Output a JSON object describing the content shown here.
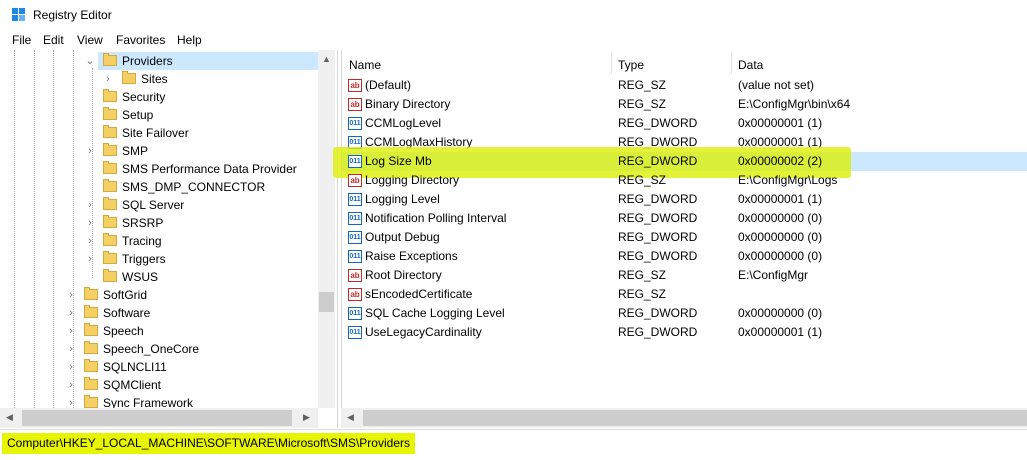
{
  "window": {
    "title": "Registry Editor"
  },
  "menu": [
    "File",
    "Edit",
    "View",
    "Favorites",
    "Help"
  ],
  "tree": {
    "nodes": [
      {
        "label": "Providers",
        "expanded": true
      },
      {
        "label": "Sites"
      },
      {
        "label": "Security"
      },
      {
        "label": "Setup"
      },
      {
        "label": "Site Failover"
      },
      {
        "label": "SMP"
      },
      {
        "label": "SMS Performance Data Provider"
      },
      {
        "label": "SMS_DMP_CONNECTOR"
      },
      {
        "label": "SQL Server"
      },
      {
        "label": "SRSRP"
      },
      {
        "label": "Tracing"
      },
      {
        "label": "Triggers"
      },
      {
        "label": "WSUS"
      },
      {
        "label": "SoftGrid"
      },
      {
        "label": "Software"
      },
      {
        "label": "Speech"
      },
      {
        "label": "Speech_OneCore"
      },
      {
        "label": "SQLNCLI11"
      },
      {
        "label": "SQMClient"
      },
      {
        "label": "Sync Framework"
      }
    ]
  },
  "list": {
    "columns": [
      "Name",
      "Type",
      "Data"
    ],
    "rows": [
      {
        "name": "(Default)",
        "type": "REG_SZ",
        "data": "(value not set)",
        "icon": "string-value-icon"
      },
      {
        "name": "Binary Directory",
        "type": "REG_SZ",
        "data": "E:\\ConfigMgr\\bin\\x64",
        "icon": "string-value-icon"
      },
      {
        "name": "CCMLogLevel",
        "type": "REG_DWORD",
        "data": "0x00000001 (1)",
        "icon": "dword-value-icon"
      },
      {
        "name": "CCMLogMaxHistory",
        "type": "REG_DWORD",
        "data": "0x00000001 (1)",
        "icon": "dword-value-icon"
      },
      {
        "name": "Log Size Mb",
        "type": "REG_DWORD",
        "data": "0x00000002 (2)",
        "icon": "dword-value-icon"
      },
      {
        "name": "Logging Directory",
        "type": "REG_SZ",
        "data": "E:\\ConfigMgr\\Logs",
        "icon": "string-value-icon"
      },
      {
        "name": "Logging Level",
        "type": "REG_DWORD",
        "data": "0x00000001 (1)",
        "icon": "dword-value-icon"
      },
      {
        "name": "Notification Polling Interval",
        "type": "REG_DWORD",
        "data": "0x00000000 (0)",
        "icon": "dword-value-icon"
      },
      {
        "name": "Output Debug",
        "type": "REG_DWORD",
        "data": "0x00000000 (0)",
        "icon": "dword-value-icon"
      },
      {
        "name": "Raise Exceptions",
        "type": "REG_DWORD",
        "data": "0x00000000 (0)",
        "icon": "dword-value-icon"
      },
      {
        "name": "Root Directory",
        "type": "REG_SZ",
        "data": "E:\\ConfigMgr",
        "icon": "string-value-icon"
      },
      {
        "name": "sEncodedCertificate",
        "type": "REG_SZ",
        "data": "",
        "icon": "string-value-icon"
      },
      {
        "name": "SQL Cache Logging Level",
        "type": "REG_DWORD",
        "data": "0x00000000 (0)",
        "icon": "dword-value-icon"
      },
      {
        "name": "UseLegacyCardinality",
        "type": "REG_DWORD",
        "data": "0x00000001 (1)",
        "icon": "dword-value-icon"
      }
    ]
  },
  "icon_glyphs": {
    "string": "ab",
    "dword": "011"
  },
  "status": {
    "path": "Computer\\HKEY_LOCAL_MACHINE\\SOFTWARE\\Microsoft\\SMS\\Providers"
  },
  "colors": {
    "highlight": "#e8f500",
    "selection": "#cce8ff"
  }
}
